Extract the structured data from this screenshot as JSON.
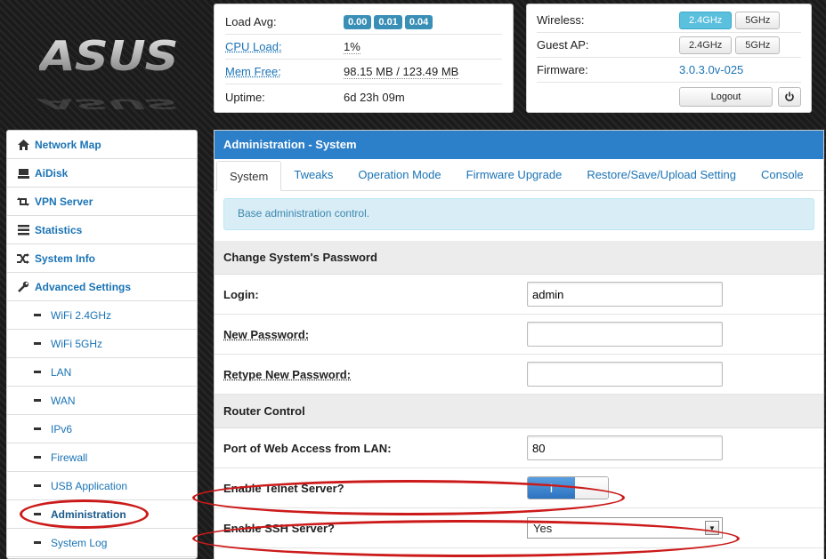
{
  "brand": {
    "logo_text": "ASUS"
  },
  "status": {
    "load_avg": {
      "label": "Load Avg:",
      "values": [
        "0.00",
        "0.01",
        "0.04"
      ]
    },
    "cpu_load": {
      "label": "CPU Load:",
      "value": "1%"
    },
    "mem_free": {
      "label": "Mem Free:",
      "value": "98.15 MB / 123.49 MB"
    },
    "uptime": {
      "label": "Uptime:",
      "value": "6d 23h 09m"
    }
  },
  "wifi": {
    "wireless": {
      "label": "Wireless:",
      "btn_24": "2.4GHz",
      "btn_5": "5GHz",
      "active": "2.4GHz"
    },
    "guest": {
      "label": "Guest AP:",
      "btn_24": "2.4GHz",
      "btn_5": "5GHz"
    },
    "firmware": {
      "label": "Firmware:",
      "value": "3.0.3.0v-025"
    },
    "logout_label": "Logout"
  },
  "sidebar": {
    "items": [
      {
        "label": "Network Map",
        "icon": "home-icon"
      },
      {
        "label": "AiDisk",
        "icon": "disk-icon"
      },
      {
        "label": "VPN Server",
        "icon": "retweet-icon"
      },
      {
        "label": "Statistics",
        "icon": "list-icon"
      },
      {
        "label": "System Info",
        "icon": "shuffle-icon"
      },
      {
        "label": "Advanced Settings",
        "icon": "wrench-icon"
      }
    ],
    "sub_items": [
      {
        "label": "WiFi 2.4GHz"
      },
      {
        "label": "WiFi 5GHz"
      },
      {
        "label": "LAN"
      },
      {
        "label": "WAN"
      },
      {
        "label": "IPv6"
      },
      {
        "label": "Firewall"
      },
      {
        "label": "USB Application"
      },
      {
        "label": "Administration"
      },
      {
        "label": "System Log"
      }
    ]
  },
  "main": {
    "title": "Administration - System",
    "tabs": [
      "System",
      "Tweaks",
      "Operation Mode",
      "Firmware Upgrade",
      "Restore/Save/Upload Setting",
      "Console"
    ],
    "active_tab": "System",
    "info": "Base administration control.",
    "password_section": {
      "title": "Change System's Password",
      "login_label": "Login:",
      "login_value": "admin",
      "new_password_label": "New Password:",
      "retype_label": "Retype New Password:"
    },
    "router_section": {
      "title": "Router Control",
      "port_label": "Port of Web Access from LAN:",
      "port_value": "80",
      "telnet_label": "Enable Telnet Server?",
      "telnet_toggle_on": "I",
      "ssh_label": "Enable SSH Server?",
      "ssh_value": "Yes"
    }
  },
  "colors": {
    "accent": "#2c7fc9",
    "highlight_circle": "#cc1a1a",
    "badge": "#3a8fb7"
  }
}
